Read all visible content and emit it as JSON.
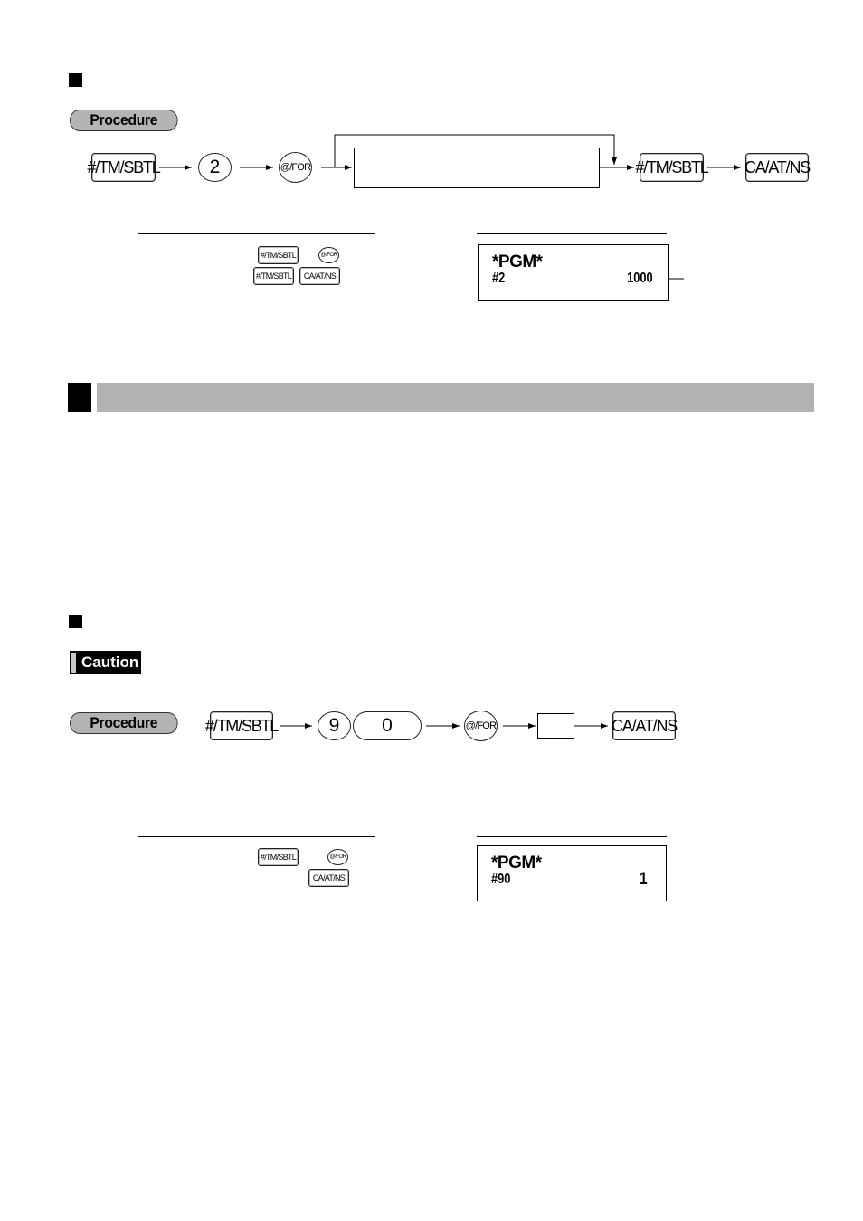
{
  "section1": {
    "procedure_label": "Procedure",
    "sequence": {
      "key1": "#/TM/SBTL",
      "key2": "2",
      "key3": "@/FOR",
      "entry_box": "",
      "key4": "#/TM/SBTL",
      "key5": "CA/AT/NS"
    },
    "key_ref": {
      "row1": [
        "#/TM/SBTL",
        "@/FOR"
      ],
      "row2": [
        "#/TM/SBTL",
        "CA/AT/NS"
      ]
    },
    "receipt": {
      "title": "*PGM*",
      "line_label": "#2",
      "line_value": "1000"
    }
  },
  "section2": {
    "caution_label": "Caution",
    "procedure_label": "Procedure",
    "sequence": {
      "key1": "#/TM/SBTL",
      "key2": "9",
      "key3": "0",
      "key4": "@/FOR",
      "entry_box": "",
      "key5": "CA/AT/NS"
    },
    "key_ref": {
      "row1": [
        "#/TM/SBTL",
        "@/FOR"
      ],
      "row2": [
        "CA/AT/NS"
      ]
    },
    "receipt": {
      "title": "*PGM*",
      "line_label": "#90",
      "line_value": "1"
    }
  },
  "colors": {
    "section_bar": "#b2b2b2",
    "procedure_badge": "#b4b4b4",
    "caution_bg": "#000000"
  }
}
